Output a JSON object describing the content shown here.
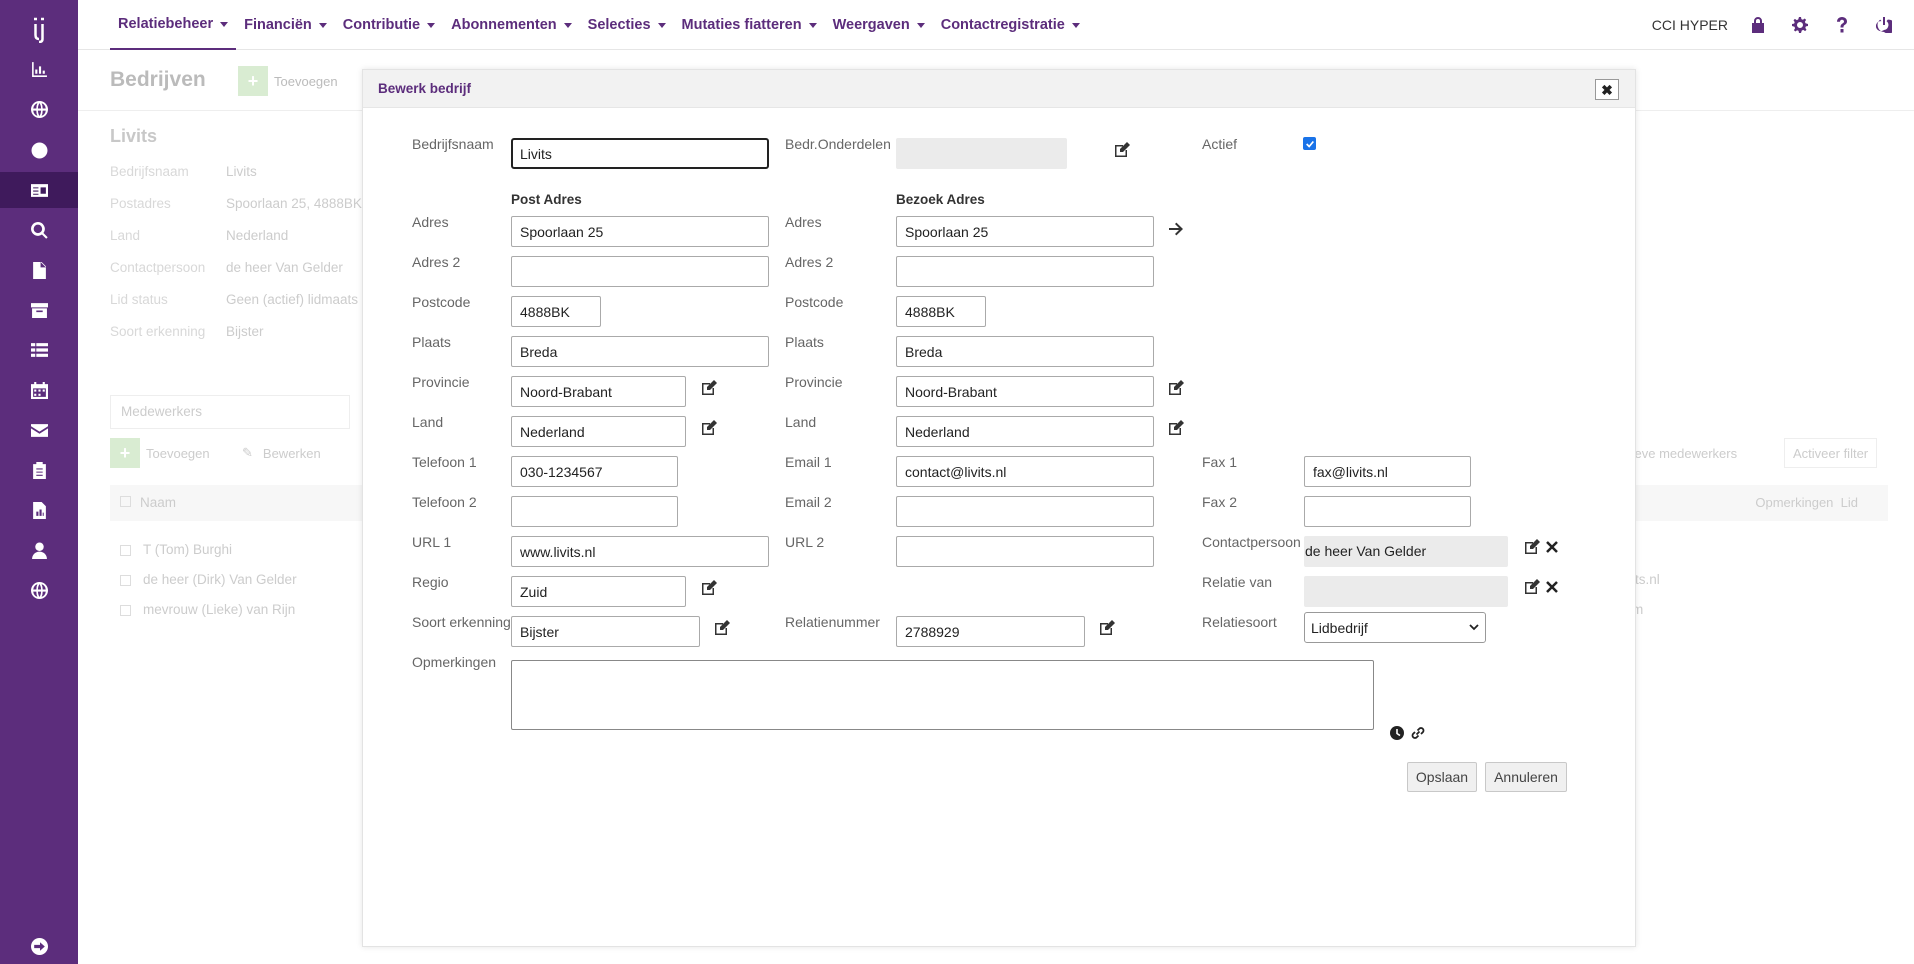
{
  "sidebar": {
    "logo": "̓ij",
    "icons": [
      "chart-icon",
      "globe-icon",
      "smiley-icon",
      "id-card-icon",
      "search-icon",
      "document-icon",
      "archive-icon",
      "list-icon",
      "calendar-icon",
      "mail-icon",
      "clipboard-icon",
      "report-icon",
      "user-icon",
      "globe2-icon"
    ],
    "bottom_icon": "logout-icon"
  },
  "topnav": {
    "items": [
      "Relatiebeheer",
      "Financiën",
      "Contributie",
      "Abonnementen",
      "Selecties",
      "Mutaties fiatteren",
      "Weergaven",
      "Contactregistratie"
    ],
    "org": "CCI HYPER"
  },
  "background": {
    "title": "Bedrijven",
    "add": "Toevoegen",
    "name": "Livits",
    "rows": [
      {
        "label": "Bedrijfsnaam",
        "value": "Livits"
      },
      {
        "label": "Postadres",
        "value": "Spoorlaan 25, 4888BK"
      },
      {
        "label": "Land",
        "value": "Nederland"
      },
      {
        "label": "Contactpersoon",
        "value": "de heer Van Gelder"
      },
      {
        "label": "Lid status",
        "value": "Geen (actief) lidmaats"
      },
      {
        "label": "Soort erkenning",
        "value": "Bijster"
      }
    ],
    "panel": "Medewerkers",
    "tb_add": "Toevoegen",
    "tb_edit": "Bewerken",
    "col_name": "Naam",
    "col_opm": "Opmerkingen",
    "col_lid": "Lid",
    "people": [
      "T (Tom) Burghi",
      "de heer (Dirk) Van Gelder",
      "mevrouw (Lieke) van Rijn"
    ],
    "right_text": "tieve medewerkers",
    "right_btn": "Activeer filter",
    "row2_right": "its.nl",
    "row3_right": "m"
  },
  "modal": {
    "title": "Bewerk bedrijf",
    "close": "✖",
    "labels": {
      "bedrijfsnaam": "Bedrijfsnaam",
      "onderdelen": "Bedr.Onderdelen",
      "actief": "Actief",
      "post": "Post Adres",
      "bezoek": "Bezoek Adres",
      "adres": "Adres",
      "adres2": "Adres 2",
      "postcode": "Postcode",
      "plaats": "Plaats",
      "provincie": "Provincie",
      "land": "Land",
      "tel1": "Telefoon 1",
      "tel2": "Telefoon 2",
      "email1": "Email 1",
      "email2": "Email 2",
      "fax1": "Fax 1",
      "fax2": "Fax 2",
      "url1": "URL 1",
      "url2": "URL 2",
      "contact": "Contactpersoon",
      "regio": "Regio",
      "relatievan": "Relatie van",
      "erkenning": "Soort erkenning",
      "relnr": "Relatienummer",
      "relsoort": "Relatiesoort",
      "opm": "Opmerkingen"
    },
    "values": {
      "bedrijfsnaam": "Livits",
      "post_adres": "Spoorlaan 25",
      "post_postcode": "4888BK",
      "post_plaats": "Breda",
      "post_provincie": "Noord-Brabant",
      "post_land": "Nederland",
      "bez_adres": "Spoorlaan 25",
      "bez_postcode": "4888BK",
      "bez_plaats": "Breda",
      "bez_provincie": "Noord-Brabant",
      "bez_land": "Nederland",
      "tel1": "030-1234567",
      "email1": "contact@livits.nl",
      "fax1": "fax@livits.nl",
      "url1": "www.livits.nl",
      "contact": "de heer Van Gelder",
      "regio": "Zuid",
      "erkenning": "Bijster",
      "relnr": "2788929",
      "relsoort": "Lidbedrijf"
    },
    "save": "Opslaan",
    "cancel": "Annuleren"
  },
  "colors": {
    "brand": "#5c2d7c",
    "brand_dark": "#3f1a5c",
    "checkbox": "#1a73e8"
  }
}
